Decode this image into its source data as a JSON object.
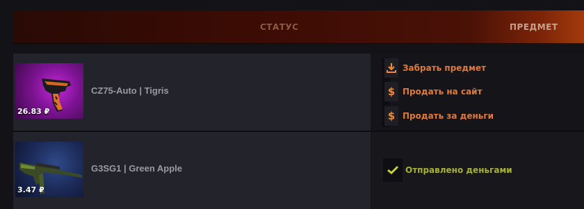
{
  "header": {
    "status_label": "СТАТУС",
    "item_label": "ПРЕДМЕТ"
  },
  "colors": {
    "accent_orange": "#e07a3c",
    "success_green": "#a8b238",
    "row_bg": "#23232b"
  },
  "items": [
    {
      "name": "CZ75-Auto | Tigris",
      "price": "26.83 ₽",
      "rarity_color": "#c328d6",
      "actions": [
        {
          "icon": "download-arrow-icon",
          "label": "Забрать предмет"
        },
        {
          "icon": "dollar-icon",
          "label": "Продать на сайт"
        },
        {
          "icon": "dollar-icon",
          "label": "Продать за деньги"
        }
      ]
    },
    {
      "name": "G3SG1 | Green Apple",
      "price": "3.47 ₽",
      "rarity_color": "#2f4a8a",
      "status": {
        "icon": "checkmark-icon",
        "label": "Отправлено деньгами"
      }
    }
  ]
}
